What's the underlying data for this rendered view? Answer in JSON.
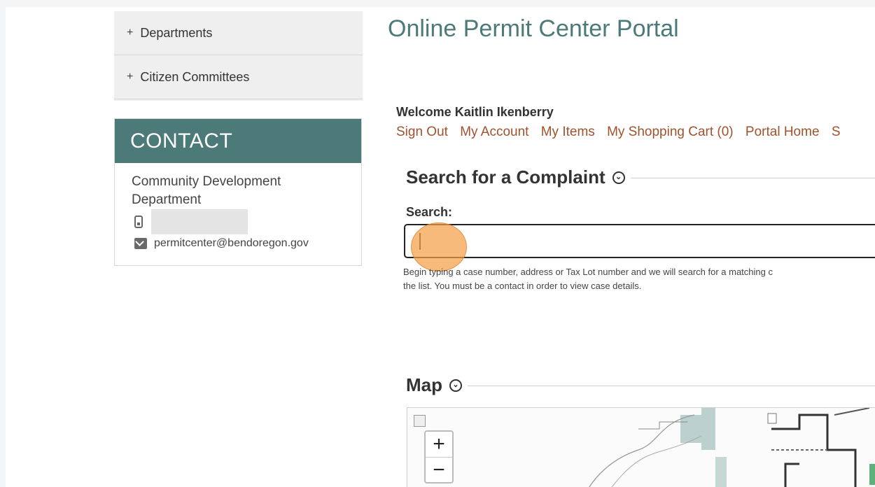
{
  "sidebar": {
    "nav": [
      {
        "label": "Departments",
        "prefix": "+"
      },
      {
        "label": "Citizen Committees",
        "prefix": "+"
      }
    ],
    "contact": {
      "heading": "CONTACT",
      "department": "Community Development Department",
      "email": "permitcenter@bendoregon.gov"
    }
  },
  "main": {
    "title": "Online Permit Center Portal",
    "welcome": "Welcome Kaitlin Ikenberry",
    "links": [
      "Sign Out",
      "My Account",
      "My Items",
      "My Shopping Cart (0)",
      "Portal Home",
      "S"
    ],
    "search_section": {
      "heading": "Search for a Complaint",
      "label": "Search:",
      "value": "",
      "help_line1": "Begin typing a case number, address or Tax Lot number and we will search for a matching c",
      "help_line2": "the list. You must be a contact in order to view case details."
    },
    "map_section": {
      "heading": "Map",
      "zoom_in": "+",
      "zoom_out": "−"
    }
  },
  "colors": {
    "accent": "#4b7a78",
    "link": "#a0522d",
    "click_marker": "#f5a046"
  }
}
